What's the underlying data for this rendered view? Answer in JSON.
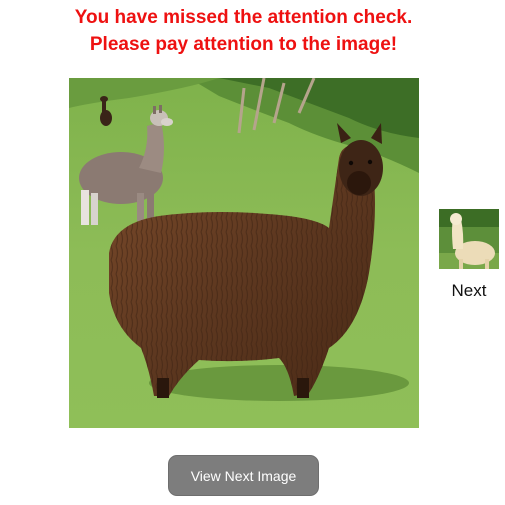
{
  "warning": {
    "line1": "You have missed the attention check.",
    "line2": "Please pay attention to the image!",
    "color": "#ee1111"
  },
  "main_image": {
    "icon": "alpaca-photo",
    "subject": "brown alpaca on grass"
  },
  "thumbnail": {
    "icon": "alpaca-thumbnail",
    "label": "Next"
  },
  "buttons": {
    "view_next_label": "View Next Image",
    "color": "#7d7d7d"
  }
}
